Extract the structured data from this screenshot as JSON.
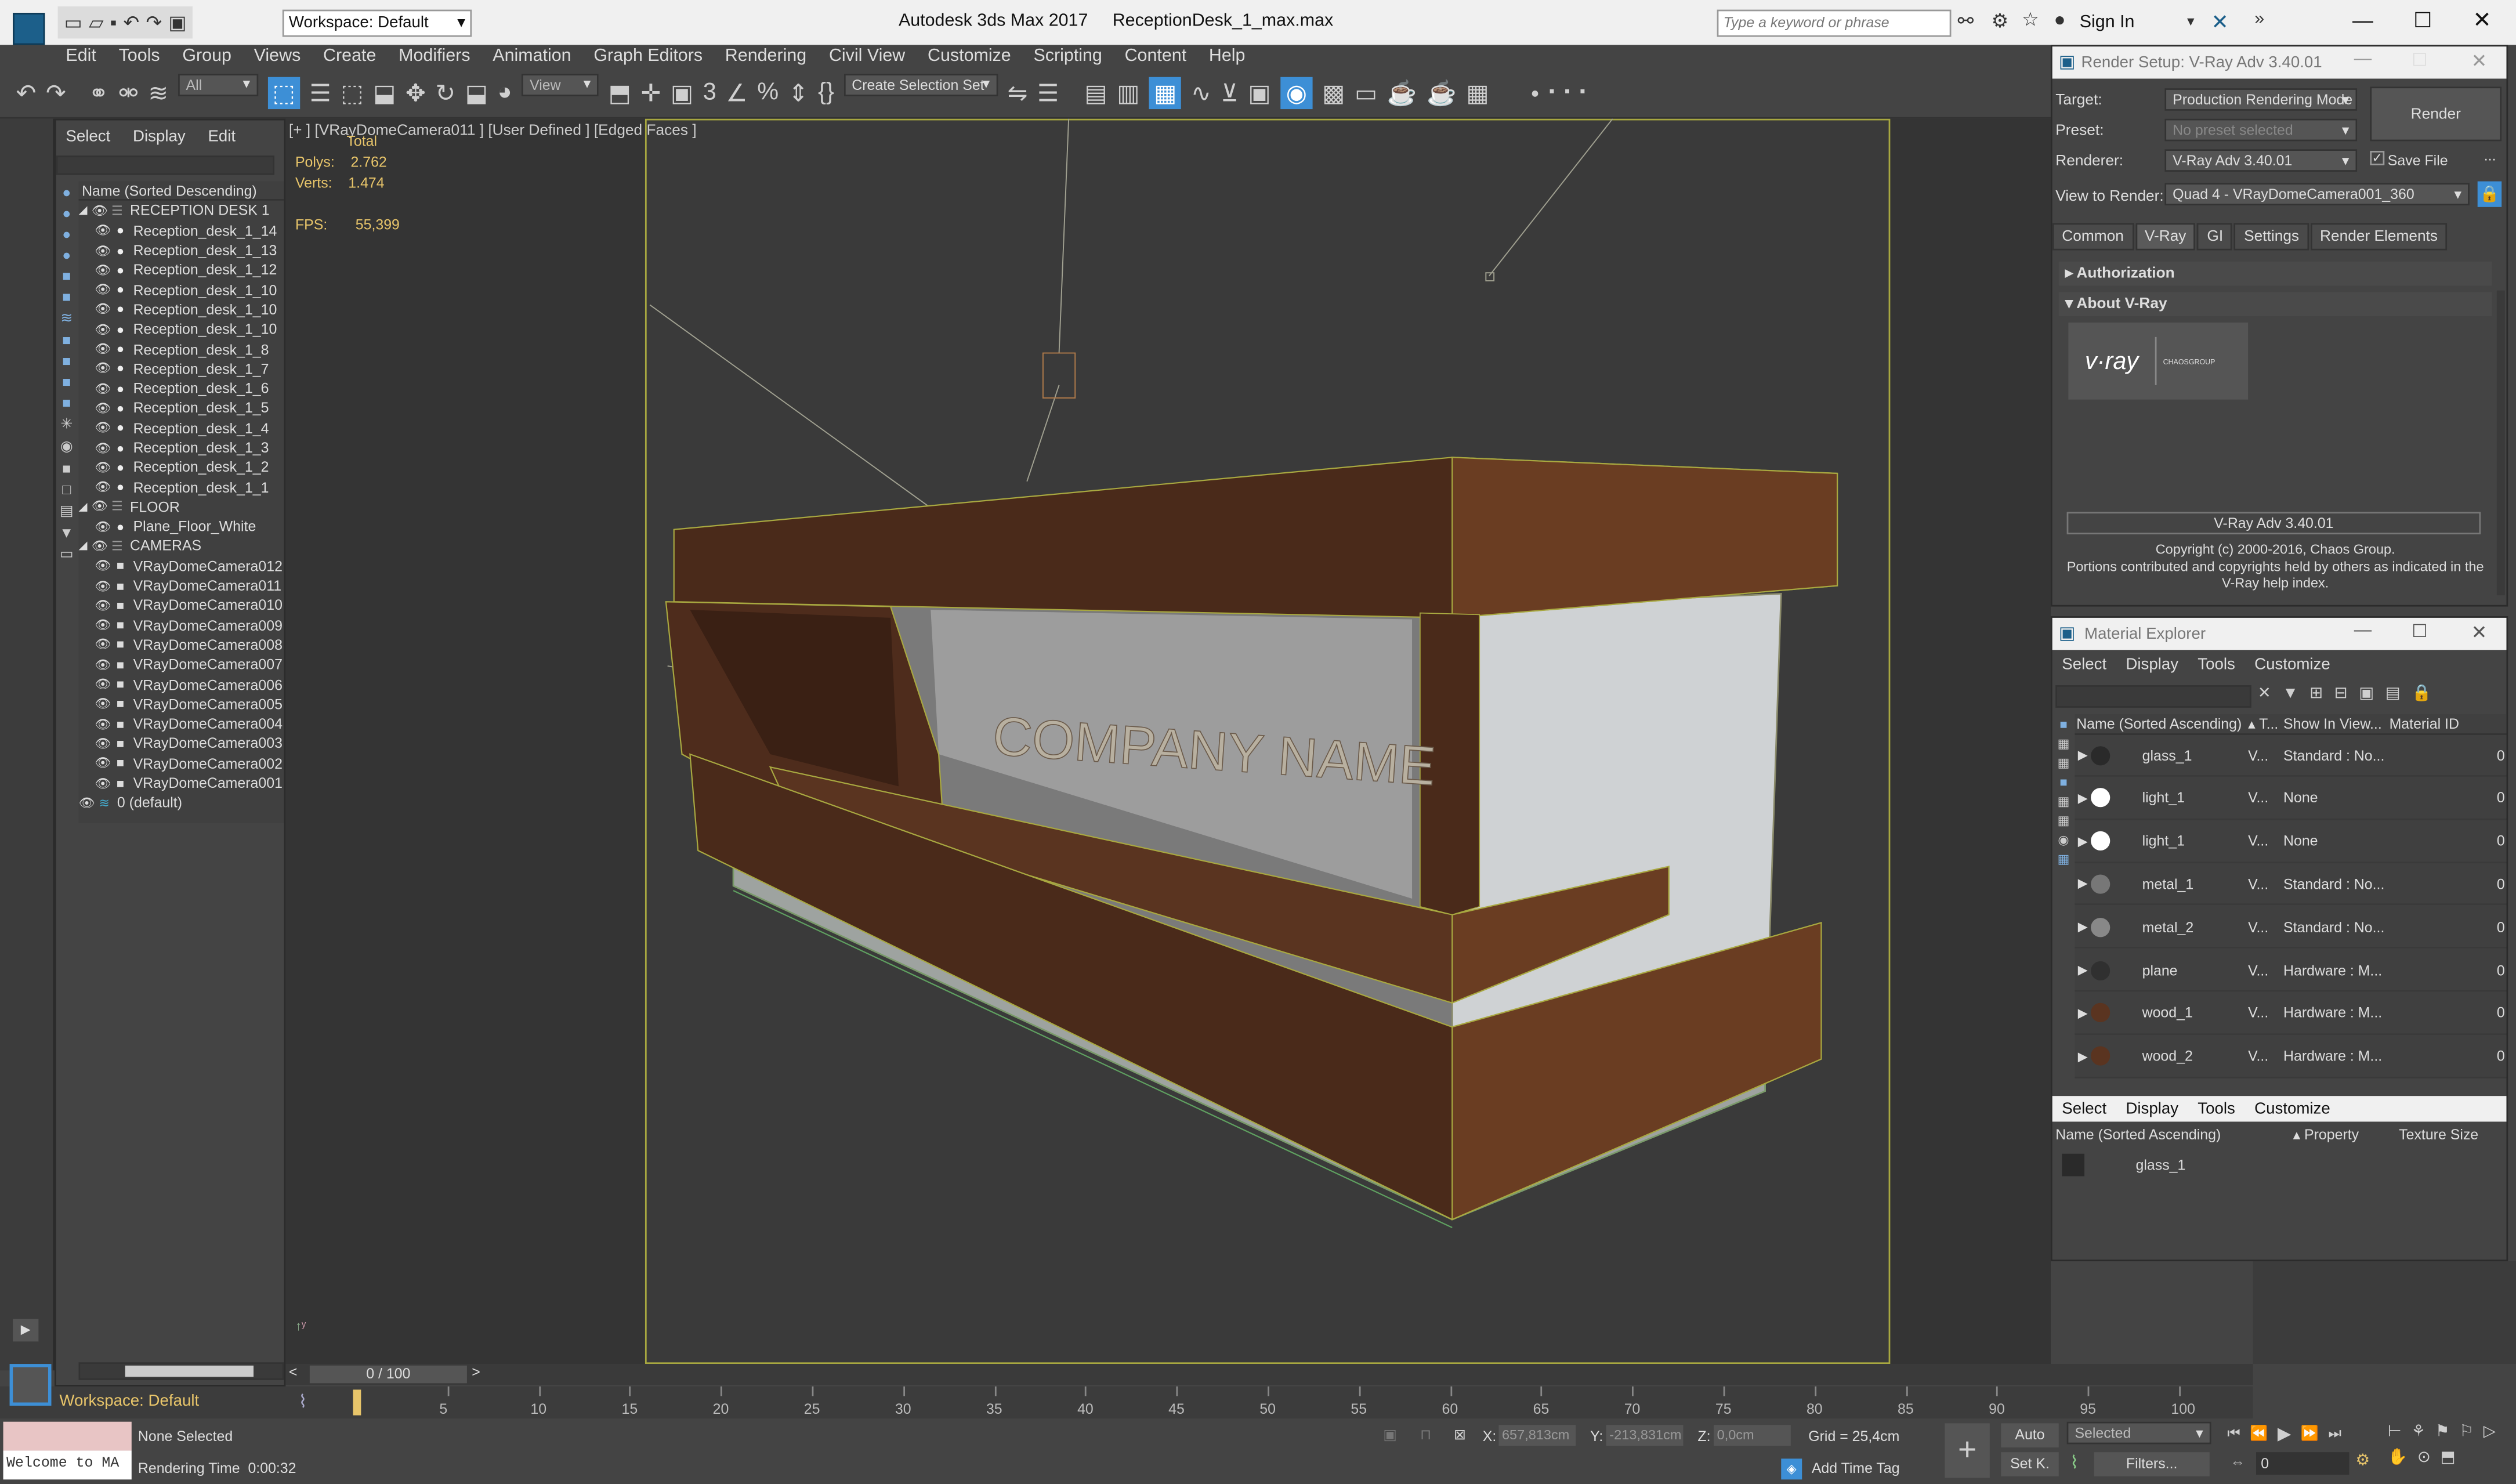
{
  "app": {
    "title": "Autodesk 3ds Max 2017",
    "file": "ReceptionDesk_1_max.max",
    "workspace": "Workspace: Default",
    "search_placeholder": "Type a keyword or phrase",
    "sign_in": "Sign In"
  },
  "menu": [
    "Edit",
    "Tools",
    "Group",
    "Views",
    "Create",
    "Modifiers",
    "Animation",
    "Graph Editors",
    "Rendering",
    "Civil View",
    "Customize",
    "Scripting",
    "Content",
    "Help"
  ],
  "toolbar": {
    "filter": "All",
    "view": "View",
    "selection_set": "Create Selection Set"
  },
  "scene_explorer": {
    "tabs": [
      "Select",
      "Display",
      "Edit"
    ],
    "header": "Name (Sorted Descending)",
    "items": [
      {
        "label": "RECEPTION DESK 1",
        "level": 0,
        "type": "layer"
      },
      {
        "label": "Reception_desk_1_14",
        "level": 1,
        "type": "obj"
      },
      {
        "label": "Reception_desk_1_13",
        "level": 1,
        "type": "obj"
      },
      {
        "label": "Reception_desk_1_12",
        "level": 1,
        "type": "obj"
      },
      {
        "label": "Reception_desk_1_10",
        "level": 1,
        "type": "obj"
      },
      {
        "label": "Reception_desk_1_10",
        "level": 1,
        "type": "obj"
      },
      {
        "label": "Reception_desk_1_10",
        "level": 1,
        "type": "obj"
      },
      {
        "label": "Reception_desk_1_8",
        "level": 1,
        "type": "obj"
      },
      {
        "label": "Reception_desk_1_7",
        "level": 1,
        "type": "obj"
      },
      {
        "label": "Reception_desk_1_6",
        "level": 1,
        "type": "obj"
      },
      {
        "label": "Reception_desk_1_5",
        "level": 1,
        "type": "obj"
      },
      {
        "label": "Reception_desk_1_4",
        "level": 1,
        "type": "obj"
      },
      {
        "label": "Reception_desk_1_3",
        "level": 1,
        "type": "obj"
      },
      {
        "label": "Reception_desk_1_2",
        "level": 1,
        "type": "obj"
      },
      {
        "label": "Reception_desk_1_1",
        "level": 1,
        "type": "obj"
      },
      {
        "label": "FLOOR",
        "level": 0,
        "type": "layer"
      },
      {
        "label": "Plane_Floor_White",
        "level": 1,
        "type": "obj"
      },
      {
        "label": "CAMERAS",
        "level": 0,
        "type": "layer"
      },
      {
        "label": "VRayDomeCamera012",
        "level": 1,
        "type": "cam"
      },
      {
        "label": "VRayDomeCamera011",
        "level": 1,
        "type": "cam"
      },
      {
        "label": "VRayDomeCamera010",
        "level": 1,
        "type": "cam"
      },
      {
        "label": "VRayDomeCamera009",
        "level": 1,
        "type": "cam"
      },
      {
        "label": "VRayDomeCamera008",
        "level": 1,
        "type": "cam"
      },
      {
        "label": "VRayDomeCamera007",
        "level": 1,
        "type": "cam"
      },
      {
        "label": "VRayDomeCamera006",
        "level": 1,
        "type": "cam"
      },
      {
        "label": "VRayDomeCamera005",
        "level": 1,
        "type": "cam"
      },
      {
        "label": "VRayDomeCamera004",
        "level": 1,
        "type": "cam"
      },
      {
        "label": "VRayDomeCamera003",
        "level": 1,
        "type": "cam"
      },
      {
        "label": "VRayDomeCamera002",
        "level": 1,
        "type": "cam"
      },
      {
        "label": "VRayDomeCamera001",
        "level": 1,
        "type": "cam"
      },
      {
        "label": "0 (default)",
        "level": 0,
        "type": "default"
      }
    ],
    "workspace_footer": "Workspace: Default"
  },
  "viewport": {
    "label": "[+ ] [VRayDomeCamera011 ] [User Defined ] [Edged Faces ]",
    "stats": {
      "total": "Total",
      "polys_label": "Polys:",
      "polys": "2.762",
      "verts_label": "Verts:",
      "verts": "1.474",
      "fps_label": "FPS:",
      "fps": "55,399"
    },
    "logo_text": "COMPANY NAME"
  },
  "render_setup": {
    "title": "Render Setup: V-Ray Adv 3.40.01",
    "target_label": "Target:",
    "target": "Production Rendering Mode",
    "preset_label": "Preset:",
    "preset": "No preset selected",
    "renderer_label": "Renderer:",
    "renderer": "V-Ray Adv 3.40.01",
    "save_file": "Save File",
    "view_label": "View to Render:",
    "view": "Quad 4 - VRayDomeCamera001_360",
    "render_button": "Render",
    "tabs": [
      "Common",
      "V-Ray",
      "GI",
      "Settings",
      "Render Elements"
    ],
    "rollouts": [
      "Authorization",
      "About V-Ray"
    ],
    "version_box": "V-Ray Adv 3.40.01",
    "copyright": "Copyright (c) 2000-2016, Chaos Group.",
    "portions": "Portions contributed and copyrights held by others as indicated in the V-Ray help index.",
    "logo": "v·ray",
    "chaos": "CHAOSGROUP"
  },
  "material_explorer": {
    "title": "Material Explorer",
    "menu": [
      "Select",
      "Display",
      "Tools",
      "Customize"
    ],
    "headers": {
      "name": "Name (Sorted Ascending)",
      "type": "▴ T...",
      "show": "Show In View...",
      "id": "Material ID"
    },
    "rows": [
      {
        "name": "glass_1",
        "type": "V...",
        "show": "Standard : No...",
        "id": "0",
        "swatch": "#2a2a2a"
      },
      {
        "name": "light_1",
        "type": "V...",
        "show": "None",
        "id": "0",
        "swatch": "#ffffff"
      },
      {
        "name": "light_1",
        "type": "V...",
        "show": "None",
        "id": "0",
        "swatch": "#ffffff"
      },
      {
        "name": "metal_1",
        "type": "V...",
        "show": "Standard : No...",
        "id": "0",
        "swatch": "#777777"
      },
      {
        "name": "metal_2",
        "type": "V...",
        "show": "Standard : No...",
        "id": "0",
        "swatch": "#888888"
      },
      {
        "name": "plane",
        "type": "V...",
        "show": "Hardware : M...",
        "id": "0",
        "swatch": "#303030"
      },
      {
        "name": "wood_1",
        "type": "V...",
        "show": "Hardware : M...",
        "id": "0",
        "swatch": "#5a3420"
      },
      {
        "name": "wood_2",
        "type": "V...",
        "show": "Hardware : M...",
        "id": "0",
        "swatch": "#5a3420"
      }
    ],
    "menu2": [
      "Select",
      "Display",
      "Tools",
      "Customize"
    ],
    "headers2": {
      "name": "Name (Sorted Ascending)",
      "property": "▴ Property",
      "texture": "Texture Size"
    },
    "rows2": [
      {
        "name": "glass_1"
      }
    ]
  },
  "timeline": {
    "frame": "0 / 100",
    "ticks": [
      "0",
      "5",
      "10",
      "15",
      "20",
      "25",
      "30",
      "35",
      "40",
      "45",
      "50",
      "55",
      "60",
      "65",
      "70",
      "75",
      "80",
      "85",
      "90",
      "95",
      "100"
    ]
  },
  "status": {
    "maxscript": "Welcome to MA",
    "selection": "None Selected",
    "render_time": "Rendering Time  0:00:32",
    "x_label": "X:",
    "x": "657,813cm",
    "y_label": "Y:",
    "y": "-213,831cm",
    "z_label": "Z:",
    "z": "0,0cm",
    "grid": "Grid = 25,4cm",
    "add_time_tag": "Add Time Tag",
    "auto": "Auto",
    "set_key": "Set K.",
    "selected": "Selected",
    "filters": "Filters...",
    "frame_field": "0"
  }
}
